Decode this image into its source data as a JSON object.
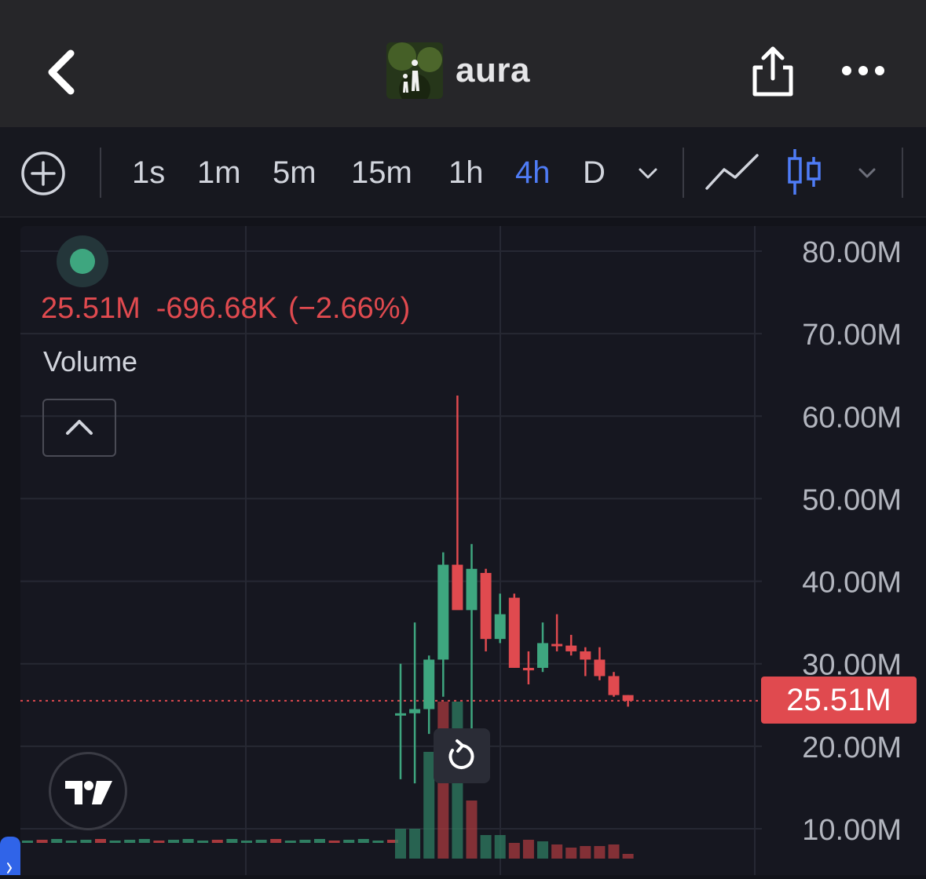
{
  "header": {
    "title": "aura",
    "back_icon": "chevron-left-icon",
    "share_icon": "share-icon",
    "more_icon": "more-dots-icon"
  },
  "toolbar": {
    "timeframes": [
      {
        "label": "1s",
        "active": false
      },
      {
        "label": "1m",
        "active": false
      },
      {
        "label": "5m",
        "active": false
      },
      {
        "label": "15m",
        "active": false
      },
      {
        "label": "1h",
        "active": false
      },
      {
        "label": "4h",
        "active": true
      },
      {
        "label": "D",
        "active": false
      }
    ],
    "active_color": "#4f7cf6"
  },
  "legend": {
    "price": "25.51M",
    "change": "-696.68K",
    "change_pct": "(−2.66%)",
    "indicator_label": "Volume"
  },
  "colors": {
    "up": "#3ea67f",
    "down": "#e04a4f",
    "background": "#161720",
    "header": "#262629"
  },
  "chart_data": {
    "type": "candlestick",
    "y_axis_labels": [
      "80.00M",
      "70.00M",
      "60.00M",
      "50.00M",
      "40.00M",
      "30.00M",
      "20.00M",
      "10.00M"
    ],
    "ylim": [
      8,
      82
    ],
    "current_price": 25.51,
    "current_price_label": "25.51M",
    "candles": [
      {
        "o": 24.0,
        "h": 30.0,
        "l": 16.0,
        "c": 24.0
      },
      {
        "o": 24.0,
        "h": 35.0,
        "l": 15.5,
        "c": 24.5
      },
      {
        "o": 24.5,
        "h": 31.0,
        "l": 21.5,
        "c": 30.5
      },
      {
        "o": 30.5,
        "h": 43.5,
        "l": 26.0,
        "c": 42.0
      },
      {
        "o": 42.0,
        "h": 62.5,
        "l": 37.0,
        "c": 36.5
      },
      {
        "o": 36.5,
        "h": 44.5,
        "l": 19.5,
        "c": 41.5
      },
      {
        "o": 41.0,
        "h": 41.5,
        "l": 31.5,
        "c": 33.0
      },
      {
        "o": 33.0,
        "h": 38.5,
        "l": 32.5,
        "c": 36.0
      },
      {
        "o": 38.0,
        "h": 38.5,
        "l": 29.5,
        "c": 29.5
      },
      {
        "o": 29.5,
        "h": 31.5,
        "l": 27.5,
        "c": 29.2
      },
      {
        "o": 29.5,
        "h": 35.0,
        "l": 29.0,
        "c": 32.5
      },
      {
        "o": 32.4,
        "h": 36.0,
        "l": 31.5,
        "c": 32.2
      },
      {
        "o": 32.2,
        "h": 33.5,
        "l": 31.0,
        "c": 31.5
      },
      {
        "o": 31.5,
        "h": 32.0,
        "l": 28.5,
        "c": 30.5
      },
      {
        "o": 30.5,
        "h": 32.0,
        "l": 28.0,
        "c": 28.5
      },
      {
        "o": 28.5,
        "h": 29.0,
        "l": 26.0,
        "c": 26.2
      },
      {
        "o": 26.2,
        "h": 26.2,
        "l": 24.8,
        "c": 25.51
      }
    ]
  }
}
